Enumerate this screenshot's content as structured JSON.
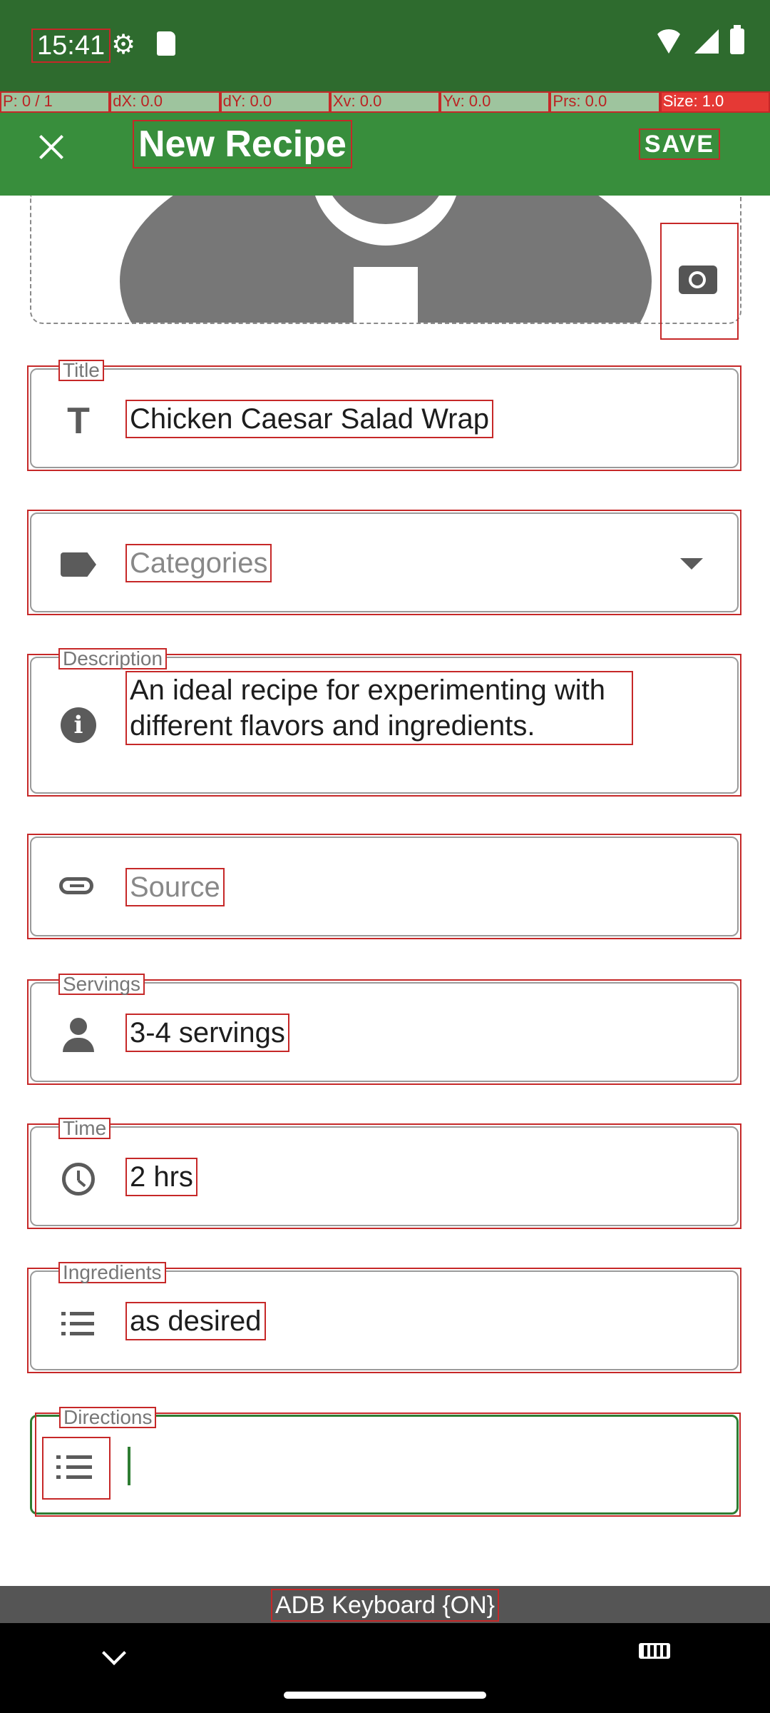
{
  "status_bar": {
    "time": "15:41"
  },
  "debug_strip": [
    "P: 0 / 1",
    "dX: 0.0",
    "dY: 0.0",
    "Xv: 0.0",
    "Yv: 0.0",
    "Prs: 0.0",
    "Size: 1.0"
  ],
  "app_bar": {
    "title": "New Recipe",
    "save_label": "SAVE"
  },
  "form": {
    "title": {
      "label": "Title",
      "value": "Chicken Caesar Salad Wrap"
    },
    "categories": {
      "placeholder": "Categories"
    },
    "description": {
      "label": "Description",
      "value": "An ideal recipe for experimenting with different flavors and ingredients."
    },
    "source": {
      "placeholder": "Source"
    },
    "servings": {
      "label": "Servings",
      "value": "3-4 servings"
    },
    "time": {
      "label": "Time",
      "value": "2 hrs"
    },
    "ingredients": {
      "label": "Ingredients",
      "value": "as desired"
    },
    "directions": {
      "label": "Directions",
      "value": ""
    }
  },
  "keyboard_bar": {
    "text": "ADB Keyboard {ON}"
  },
  "colors": {
    "status_bar": "#2e6b2e",
    "app_bar": "#388e3c",
    "focus": "#2e7d32",
    "icon": "#5b5b5b"
  }
}
